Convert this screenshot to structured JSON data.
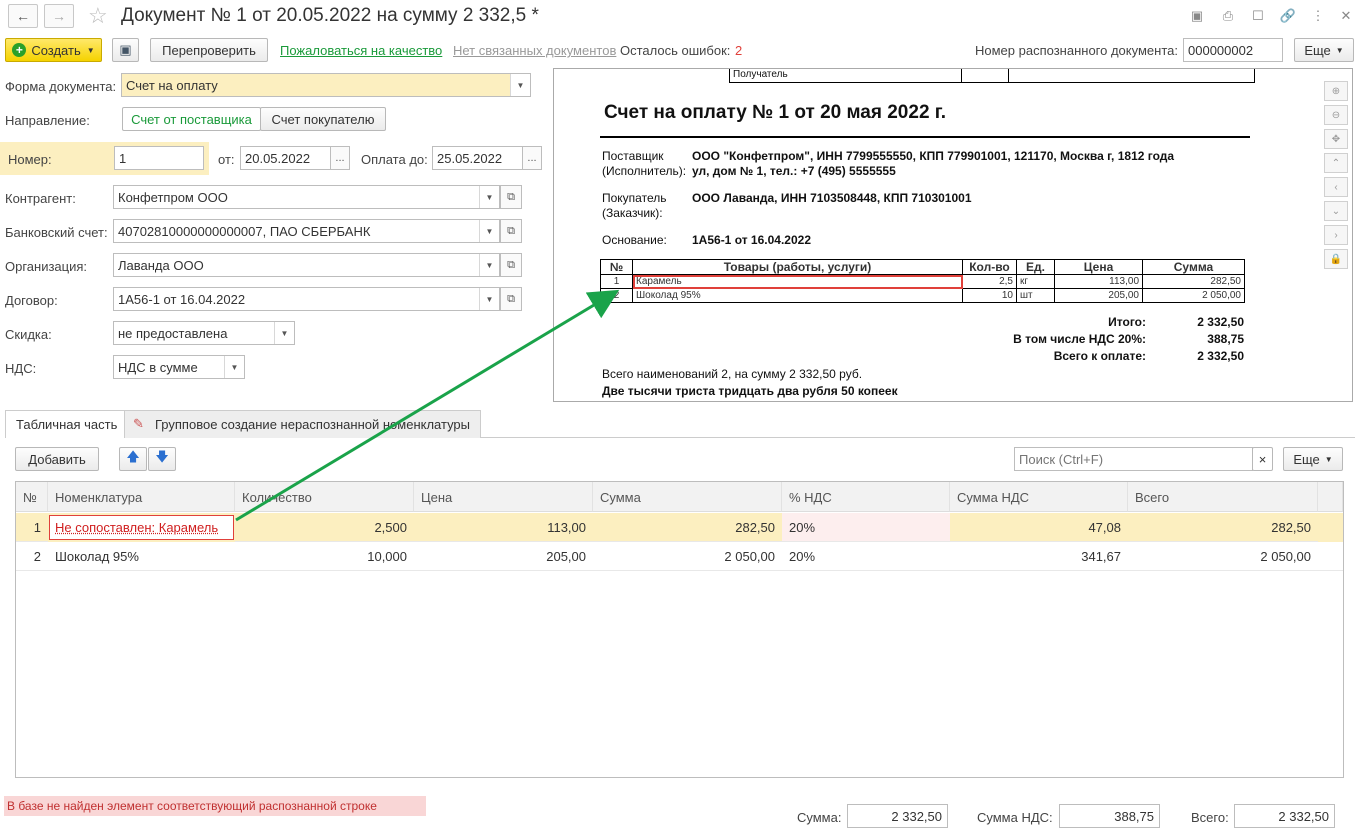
{
  "window": {
    "title": "Документ № 1 от 20.05.2022 на сумму 2 332,5 *"
  },
  "toolbar": {
    "create_label": "Создать",
    "recheck_label": "Перепроверить",
    "complain_label": "Пожаловаться на качество",
    "no_related_label": "Нет связанных документов",
    "errors_label": "Осталось ошибок:",
    "errors_count": "2",
    "recognized_number_label": "Номер распознанного документа:",
    "recognized_number_value": "000000002",
    "more_label": "Еще"
  },
  "form": {
    "doc_form_label": "Форма документа:",
    "doc_form_value": "Счет на оплату",
    "direction_label": "Направление:",
    "direction_options": [
      "Счет от поставщика",
      "Счет покупателю"
    ],
    "number_label": "Номер:",
    "number_value": "1",
    "date_from_label": "от:",
    "date_from_value": "20.05.2022",
    "pay_until_label": "Оплата до:",
    "pay_until_value": "25.05.2022",
    "counterparty_label": "Контрагент:",
    "counterparty_value": "Конфетпром ООО",
    "bank_account_label": "Банковский счет:",
    "bank_account_value": "40702810000000000007, ПАО СБЕРБАНК",
    "organization_label": "Организация:",
    "organization_value": "Лаванда ООО",
    "contract_label": "Договор:",
    "contract_value": "1А56-1 от 16.04.2022",
    "discount_label": "Скидка:",
    "discount_value": "не предоставлена",
    "vat_label": "НДС:",
    "vat_value": "НДС в сумме",
    "dots": "..."
  },
  "preview": {
    "top_cell": "Получатель",
    "heading": "Счет на оплату № 1 от 20 мая 2022 г.",
    "supplier_label_1": "Поставщик",
    "supplier_label_2": "(Исполнитель):",
    "supplier_value_1": "ООО \"Конфетпром\", ИНН 7799555550, КПП 779901001, 121170, Москва г, 1812 года",
    "supplier_value_2": "ул, дом № 1, тел.: +7 (495) 5555555",
    "buyer_label_1": "Покупатель",
    "buyer_label_2": "(Заказчик):",
    "buyer_value": "ООО Лаванда, ИНН 7103508448, КПП 710301001",
    "basis_label": "Основание:",
    "basis_value": "1А56-1 от 16.04.2022",
    "table_headers": [
      "№",
      "Товары (работы, услуги)",
      "Кол-во",
      "Ед.",
      "Цена",
      "Сумма"
    ],
    "table_rows": [
      [
        "1",
        "Карамель",
        "2,5",
        "кг",
        "113,00",
        "282,50"
      ],
      [
        "2",
        "Шоколад 95%",
        "10",
        "шт",
        "205,00",
        "2 050,00"
      ]
    ],
    "total_label": "Итого:",
    "total_value": "2 332,50",
    "vat_label": "В том числе НДС 20%:",
    "vat_value": "388,75",
    "pay_label": "Всего к оплате:",
    "pay_value": "2 332,50",
    "items_summary": "Всего наименований 2, на сумму 2 332,50 руб.",
    "amount_words": "Две тысячи триста тридцать два рубля 50 копеек"
  },
  "tabs": [
    "Табличная часть",
    "Групповое создание нераспознанной номенклатуры"
  ],
  "table_toolbar": {
    "add_label": "Добавить",
    "search_placeholder": "Поиск (Ctrl+F)",
    "more_label": "Еще",
    "clear": "×"
  },
  "grid": {
    "headers": [
      "№",
      "Номенклатура",
      "Количество",
      "Цена",
      "Сумма",
      "% НДС",
      "Сумма НДС",
      "Всего"
    ],
    "rows": [
      [
        "1",
        "Не сопоставлен: Карамель",
        "2,500",
        "113,00",
        "282,50",
        "20%",
        "47,08",
        "282,50"
      ],
      [
        "2",
        "Шоколад 95%",
        "10,000",
        "205,00",
        "2 050,00",
        "20%",
        "341,67",
        "2 050,00"
      ]
    ]
  },
  "footer": {
    "error_message": "В базе не найден элемент соответствующий распознанной строке",
    "sum_label": "Сумма:",
    "sum_value": "2 332,50",
    "vat_sum_label": "Сумма НДС:",
    "vat_sum_value": "388,75",
    "total_label": "Всего:",
    "total_value": "2 332,50"
  },
  "colors": {
    "accent_green": "#1a9a3a",
    "highlight_yellow": "#fcefc0",
    "error_red": "#e0403a",
    "error_bg": "#f9d6d6"
  }
}
